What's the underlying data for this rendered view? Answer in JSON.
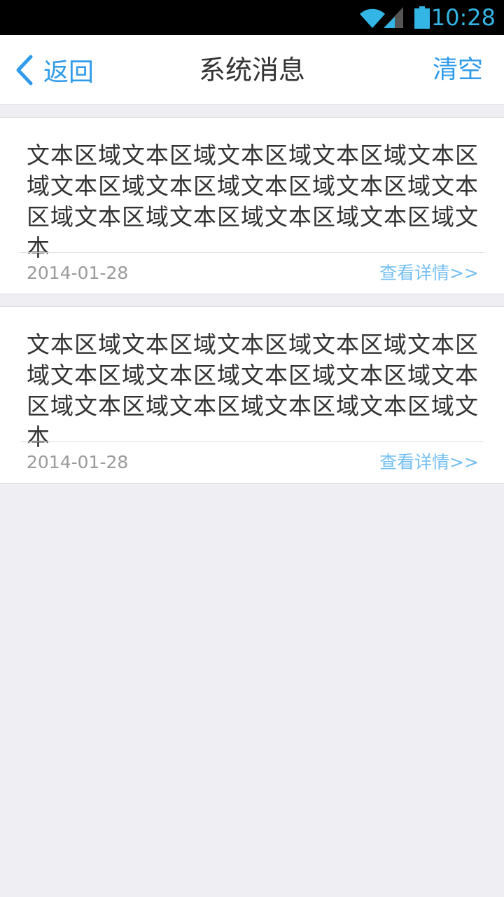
{
  "status_bar": {
    "time": "10:28",
    "icons": [
      "wifi-icon",
      "signal-icon",
      "battery-icon"
    ],
    "accent_color": "#33b5e5"
  },
  "header": {
    "back_label": "返回",
    "title": "系统消息",
    "clear_label": "清空",
    "accent_color": "#2f9bea"
  },
  "messages": [
    {
      "content": "文本区域文本区域文本区域文本区域文本区域文本区域文本区域文本区域文本区域文本区域文本区域文本区域文本区域文本区域文本",
      "date": "2014-01-28",
      "details_label": "查看详情>>"
    },
    {
      "content": "文本区域文本区域文本区域文本区域文本区域文本区域文本区域文本区域文本区域文本区域文本区域文本区域文本区域文本区域文本",
      "date": "2014-01-28",
      "details_label": "查看详情>>"
    }
  ]
}
